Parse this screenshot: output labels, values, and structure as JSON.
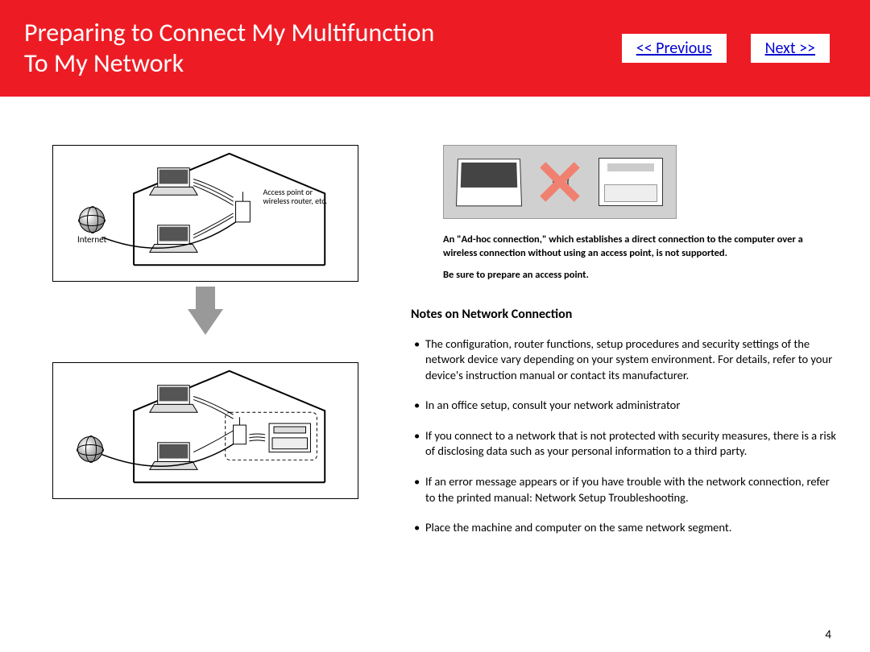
{
  "header": {
    "title_line1": "Preparing to Connect My Multifunction",
    "title_line2": "To My Network",
    "previous_label": "<< Previous",
    "next_label": "Next >>"
  },
  "diagram": {
    "internet_label": "Internet",
    "access_point_label": "Access point or\nwireless router, etc."
  },
  "adhoc": {
    "paragraph1": "An \"Ad-hoc connection,\" which establishes a direct connection to the computer over a wireless connection without using an access point, is not supported.",
    "paragraph2": "Be sure to prepare an access point."
  },
  "notes": {
    "heading": "Notes on Network Connection",
    "items": [
      "The configuration, router functions, setup procedures and security settings of the network device vary depending on your system environment. For details, refer to your device's instruction manual or contact its manufacturer.",
      "In an office setup, consult your network administrator",
      "If you connect to a network that is not protected with security measures, there is a risk of disclosing data such as your personal information to a third party.",
      "If an error message appears or if you have trouble with the network connection, refer to the printed manual: Network Setup Troubleshooting.",
      "Place the machine and computer on the same network segment."
    ]
  },
  "page_number": "4"
}
